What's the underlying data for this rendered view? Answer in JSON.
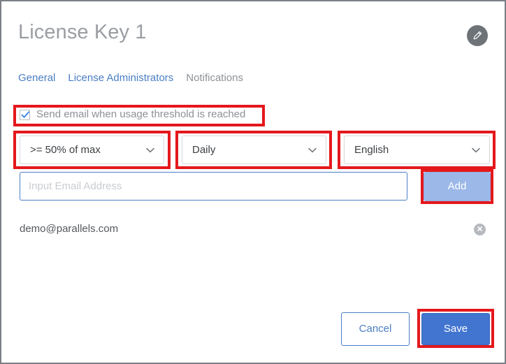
{
  "window": {
    "title": "License Key 1"
  },
  "header": {
    "edit_icon": "pencil-icon"
  },
  "tabs": [
    {
      "label": "General",
      "active": false
    },
    {
      "label": "License Administrators",
      "active": false
    },
    {
      "label": "Notifications",
      "active": true
    }
  ],
  "notifications": {
    "checkbox": {
      "label": "Send email when usage threshold is reached",
      "checked": true
    },
    "selects": [
      {
        "name": "threshold",
        "value": ">= 50% of max",
        "icon": "chevron-down-icon"
      },
      {
        "name": "frequency",
        "value": "Daily",
        "icon": "chevron-down-icon"
      },
      {
        "name": "language",
        "value": "English",
        "icon": "chevron-down-icon"
      }
    ],
    "email_input": {
      "value": "",
      "placeholder": "Input Email Address"
    },
    "add_label": "Add",
    "recipients": [
      {
        "email": "demo@parallels.com",
        "remove_icon": "close-circle-icon"
      }
    ]
  },
  "footer": {
    "cancel_label": "Cancel",
    "save_label": "Save"
  },
  "colors": {
    "accent_blue": "#4275d0",
    "link_blue": "#4a7ec4",
    "disabled_blue": "#9cb8e8",
    "annotation_red": "#e4181c",
    "title_gray": "#9a9ea3",
    "text_gray": "#54585c"
  }
}
